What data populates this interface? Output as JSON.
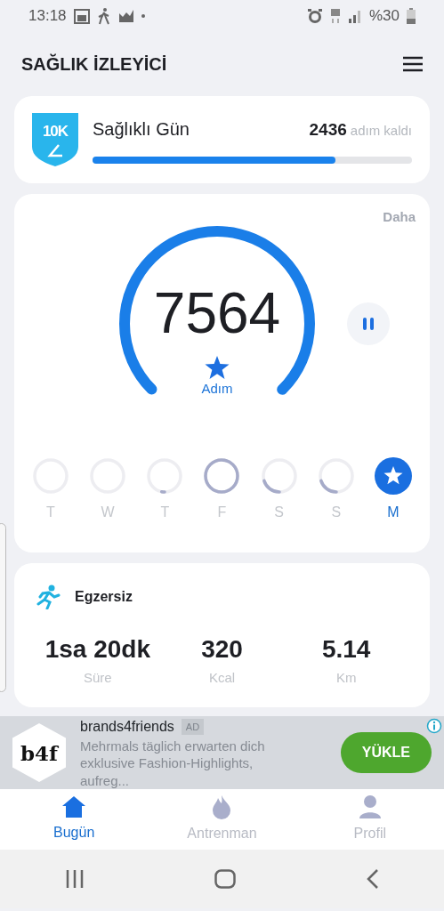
{
  "status_bar": {
    "time": "13:18",
    "battery": "%30"
  },
  "header": {
    "title": "SAĞLIK İZLEYİCİ"
  },
  "goal_card": {
    "badge": "10K",
    "title": "Sağlıklı Gün",
    "remaining": "2436",
    "remaining_label": "adım kaldı",
    "level": 0.76
  },
  "steps_card": {
    "more": "Daha",
    "count": "7564",
    "unit": "Adım",
    "days": [
      {
        "label": "T",
        "selected": false
      },
      {
        "label": "W",
        "selected": false
      },
      {
        "label": "T",
        "selected": false
      },
      {
        "label": "F",
        "selected": false
      },
      {
        "label": "S",
        "selected": false
      },
      {
        "label": "S",
        "selected": false
      },
      {
        "label": "M",
        "selected": true
      }
    ]
  },
  "exercise_card": {
    "title": "Egzersiz",
    "stats": [
      {
        "value": "1sa 20dk",
        "label": "Süre"
      },
      {
        "value": "320",
        "label": "Kcal"
      },
      {
        "value": "5.14",
        "label": "Km"
      }
    ]
  },
  "ad": {
    "logo": "b4f",
    "name": "brands4friends",
    "tag": "AD",
    "text": "Mehrmals täglich erwarten dich exklusive Fashion-Highlights, aufreg...",
    "button": "YÜKLE"
  },
  "bottom_nav": [
    {
      "label": "Bugün",
      "selected": true
    },
    {
      "label": "Antrenman",
      "selected": false
    },
    {
      "label": "Profil",
      "selected": false
    }
  ]
}
